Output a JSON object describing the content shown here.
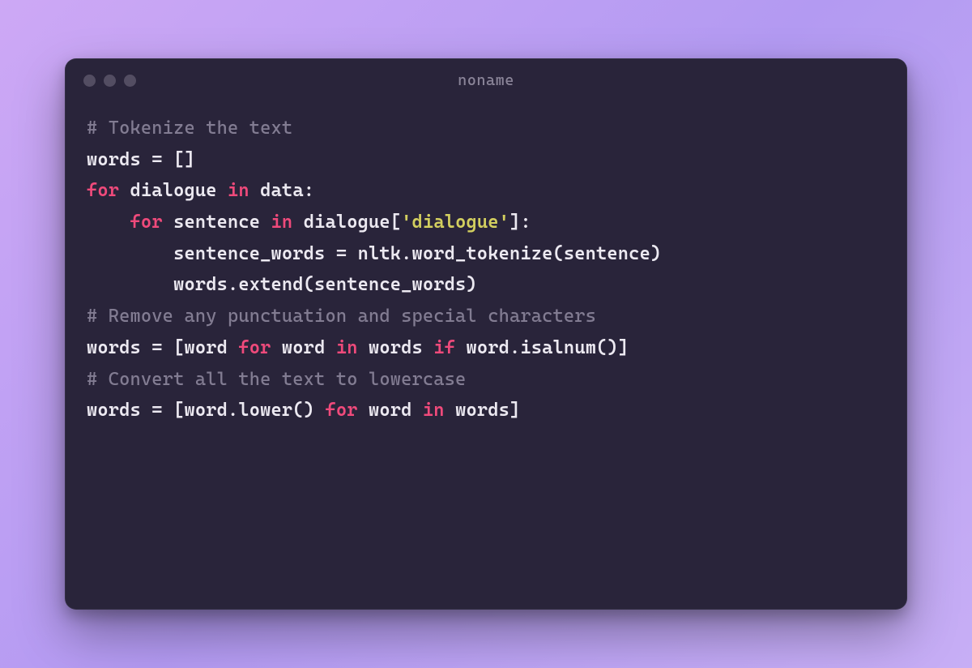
{
  "window": {
    "title": "noname"
  },
  "code": {
    "l1": {
      "comment": "# Tokenize the text"
    },
    "l2": {
      "a": "words = []"
    },
    "l3": {
      "a": "for",
      "b": " dialogue ",
      "c": "in",
      "d": " data:"
    },
    "l4": {
      "a": "    ",
      "b": "for",
      "c": " sentence ",
      "d": "in",
      "e": " dialogue[",
      "f": "'dialogue'",
      "g": "]:"
    },
    "l5": {
      "a": "        sentence_words = nltk.word_tokenize(sentence)"
    },
    "l6": {
      "a": "        words.extend(sentence_words)"
    },
    "l7": {
      "comment": "# Remove any punctuation and special characters"
    },
    "l8": {
      "a": "words = [word ",
      "b": "for",
      "c": " word ",
      "d": "in",
      "e": " words ",
      "f": "if",
      "g": " word.isalnum()]"
    },
    "l9": {
      "comment": "# Convert all the text to lowercase"
    },
    "l10": {
      "a": "words = [word.lower() ",
      "b": "for",
      "c": " word ",
      "d": "in",
      "e": " words]"
    }
  }
}
